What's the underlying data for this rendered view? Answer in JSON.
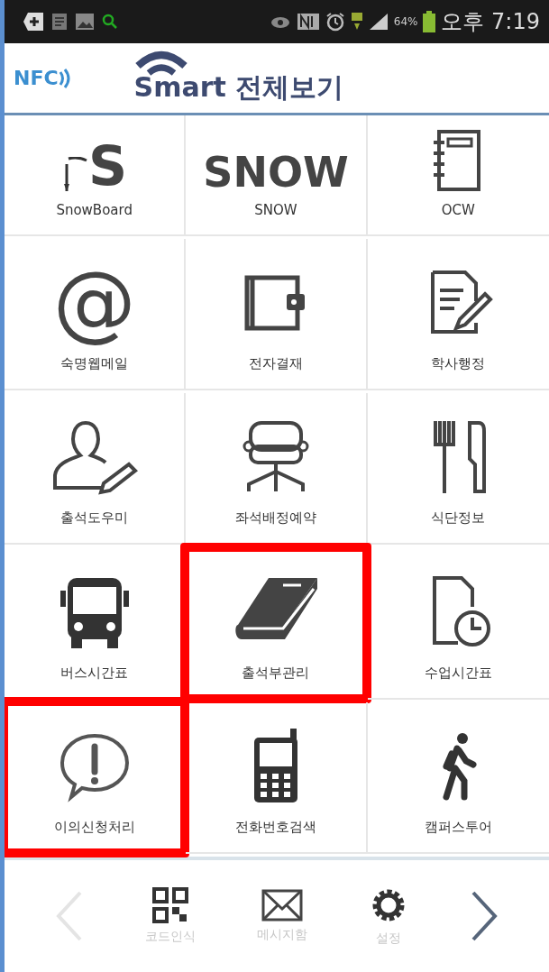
{
  "status_bar": {
    "battery": "64%",
    "time": "오후 7:19"
  },
  "header": {
    "nfc": "NFC",
    "title": "Smart 전체보기"
  },
  "grid": [
    {
      "label": "SnowBoard",
      "kind": "snowboard",
      "icon_text": "S",
      "highlighted": false
    },
    {
      "label": "SNOW",
      "kind": "logo",
      "icon_text": "SNOW",
      "highlighted": false
    },
    {
      "label": "OCW",
      "kind": "notebook",
      "highlighted": false
    },
    {
      "label": "숙명웹메일",
      "kind": "logo",
      "icon_text": "@",
      "highlighted": false
    },
    {
      "label": "전자결재",
      "kind": "wallet",
      "highlighted": false
    },
    {
      "label": "학사행정",
      "kind": "document",
      "highlighted": false
    },
    {
      "label": "출석도우미",
      "kind": "person",
      "highlighted": false
    },
    {
      "label": "좌석배정예약",
      "kind": "chair",
      "highlighted": false
    },
    {
      "label": "식단정보",
      "kind": "cutlery",
      "highlighted": false
    },
    {
      "label": "버스시간표",
      "kind": "bus",
      "highlighted": false
    },
    {
      "label": "출석부관리",
      "kind": "book",
      "highlighted": true
    },
    {
      "label": "수업시간표",
      "kind": "schedule",
      "highlighted": false
    },
    {
      "label": "이의신청처리",
      "kind": "alert",
      "highlighted": true
    },
    {
      "label": "전화번호검색",
      "kind": "phone",
      "highlighted": false
    },
    {
      "label": "캠퍼스투어",
      "kind": "walker",
      "highlighted": false
    }
  ],
  "bottom_nav": {
    "prev_disabled": true,
    "next_disabled": false,
    "items": [
      {
        "label": "코드인식",
        "kind": "qr"
      },
      {
        "label": "메시지함",
        "kind": "envelope"
      },
      {
        "label": "설정",
        "kind": "gear"
      }
    ]
  }
}
